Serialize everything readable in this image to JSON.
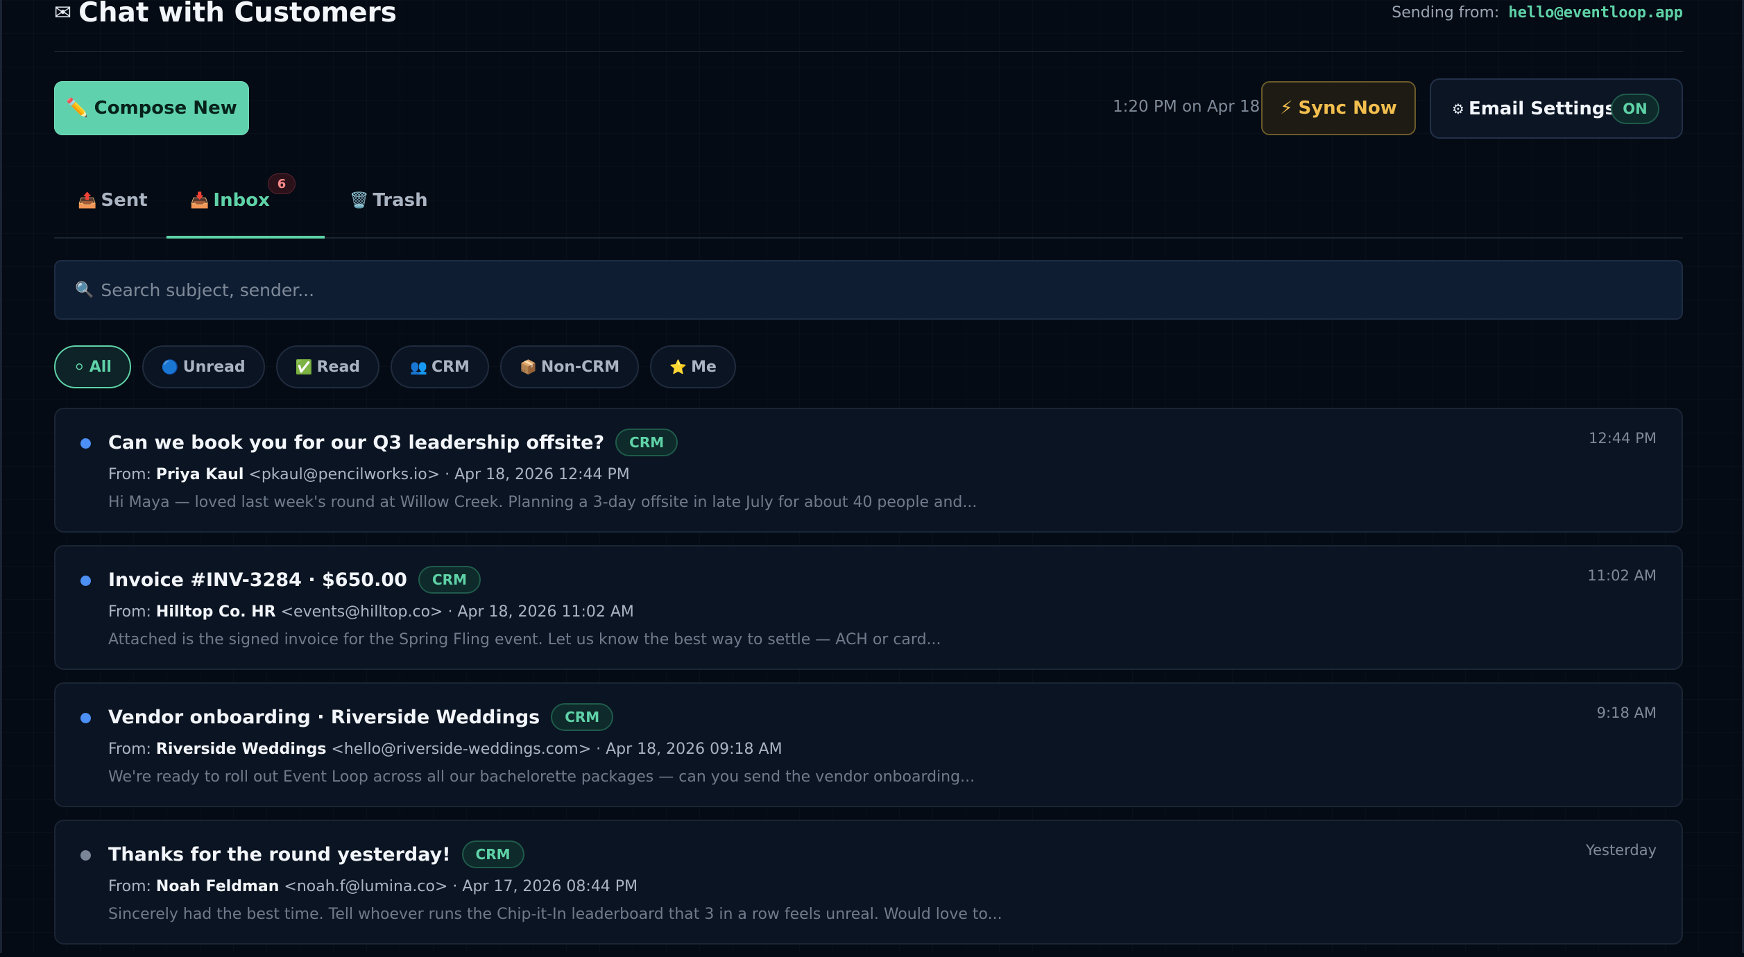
{
  "header": {
    "title_icon": "envelope-icon",
    "title": "Chat with Customers",
    "sending_label": "Sending from:",
    "sending_address": "hello@eventloop.app"
  },
  "toolbar": {
    "compose_icon": "pencil-icon",
    "compose_label": "Compose New",
    "last_sync": "1:20 PM on Apr 18",
    "sync_icon": "lightning-icon",
    "sync_label": "Sync Now",
    "settings_icon": "gear-icon",
    "settings_label": "Email Settings",
    "settings_toggle": "ON"
  },
  "tabs": [
    {
      "label": "Sent",
      "icon": "outbox-tray-icon"
    },
    {
      "label": "Inbox",
      "icon": "inbox-tray-icon",
      "badge": "6",
      "active": true
    },
    {
      "label": "Trash",
      "icon": "wastebasket-icon"
    }
  ],
  "search": {
    "placeholder": "Search subject, sender..."
  },
  "filters": [
    {
      "label": "All",
      "icon": "white-circle-icon",
      "active": true
    },
    {
      "label": "Unread",
      "icon": "blue-circle-icon"
    },
    {
      "label": "Read",
      "icon": "check-box-icon"
    },
    {
      "label": "CRM",
      "icon": "people-icon"
    },
    {
      "label": "Non-CRM",
      "icon": "package-icon"
    },
    {
      "label": "Me",
      "icon": "star-icon"
    }
  ],
  "emails": [
    {
      "subject": "Can we book you for our Q3 leadership offsite?",
      "tag": "CRM",
      "from_label": "From:",
      "sender_name": "Priya Kaul",
      "sender_detail": "<pkaul@pencilworks.io> · Apr 18, 2026 12:44 PM",
      "preview": "Hi Maya — loved last week's round at Willow Creek. Planning a 3-day offsite in late July for about 40 people and...",
      "time": "12:44 PM",
      "unread": true
    },
    {
      "subject": "Invoice #INV-3284 · $650.00",
      "tag": "CRM",
      "from_label": "From:",
      "sender_name": "Hilltop Co. HR",
      "sender_detail": "<events@hilltop.co> · Apr 18, 2026 11:02 AM",
      "preview": "Attached is the signed invoice for the Spring Fling event. Let us know the best way to settle — ACH or card...",
      "time": "11:02 AM",
      "unread": true
    },
    {
      "subject": "Vendor onboarding · Riverside Weddings",
      "tag": "CRM",
      "from_label": "From:",
      "sender_name": "Riverside Weddings",
      "sender_detail": "<hello@riverside-weddings.com> · Apr 18, 2026 09:18 AM",
      "preview": "We're ready to roll out Event Loop across all our bachelorette packages — can you send the vendor onboarding...",
      "time": "9:18 AM",
      "unread": true
    },
    {
      "subject": "Thanks for the round yesterday!",
      "tag": "CRM",
      "from_label": "From:",
      "sender_name": "Noah Feldman",
      "sender_detail": "<noah.f@lumina.co> · Apr 17, 2026 08:44 PM",
      "preview": "Sincerely had the best time. Tell whoever runs the Chip-it-In leaderboard that 3 in a row feels unreal. Would love to...",
      "time": "Yesterday",
      "unread": false
    }
  ],
  "colors": {
    "accent": "#5fd3a8",
    "sync": "#f2be4e",
    "unread_dot": "#4c8ff5",
    "read_dot": "#7a8597",
    "badge": "#ff8a8a"
  }
}
